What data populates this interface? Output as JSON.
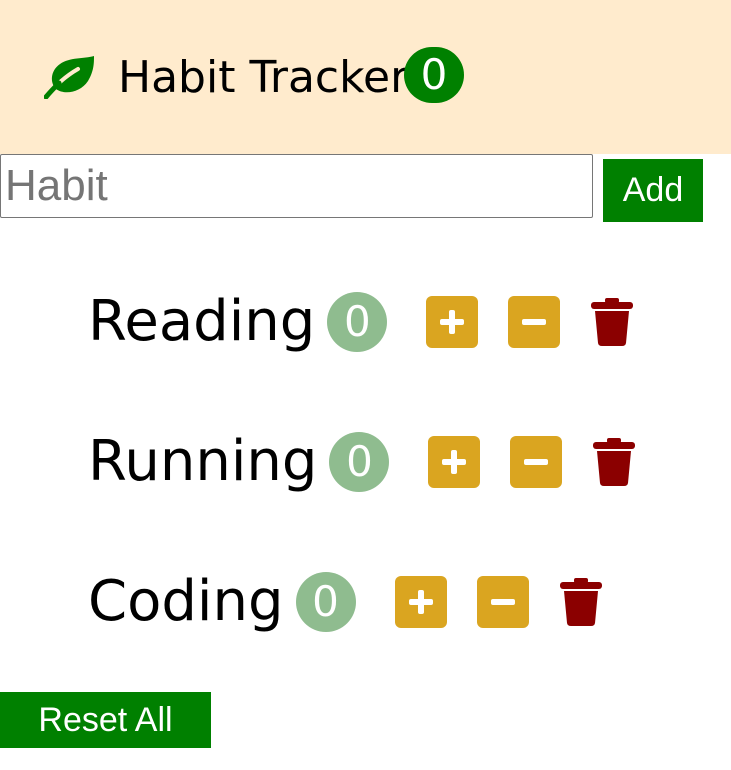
{
  "header": {
    "logo_icon": "leaf-icon",
    "title": "Habit Tracker",
    "total_count": "0"
  },
  "form": {
    "input_placeholder": "Habit",
    "input_value": "",
    "add_label": "Add"
  },
  "habits": [
    {
      "name": "Reading",
      "count": "0"
    },
    {
      "name": "Running",
      "count": "0"
    },
    {
      "name": "Coding",
      "count": "0"
    }
  ],
  "icons": {
    "increment": "plus-icon",
    "decrement": "minus-icon",
    "delete": "trash-icon"
  },
  "footer": {
    "reset_label": "Reset All"
  },
  "colors": {
    "header_bg": "#ffebcd",
    "primary_green": "#008000",
    "count_badge": "#8fbc8f",
    "step_button": "#daa520",
    "delete_icon": "#8b0000"
  }
}
